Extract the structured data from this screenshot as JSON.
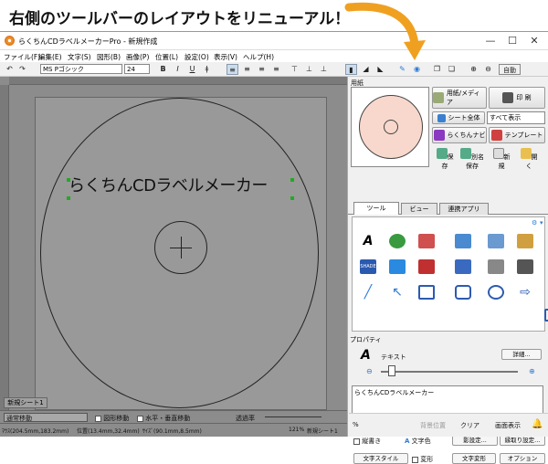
{
  "caption": "右側のツールバーのレイアウトをリニューアル！",
  "window": {
    "title": "らくちんCDラベルメーカーPro - 新規作成",
    "controls": {
      "minimize": "—",
      "maximize": "☐",
      "close": "✕"
    }
  },
  "menu": [
    "ファイル(F)",
    "編集(E)",
    "文字(S)",
    "図形(B)",
    "画像(P)",
    "位置(L)",
    "設定(O)",
    "表示(V)",
    "ヘルプ(H)"
  ],
  "format": {
    "font": "MS Pゴシック",
    "size": "24",
    "bold": "B",
    "italic": "I",
    "underline": "U",
    "strike": "ǂ",
    "zoom_label": "自動"
  },
  "canvas": {
    "label_text": "らくちんCDラベルメーカー"
  },
  "sheet_tab": "新規シート1",
  "status1": {
    "mode": "通常移動",
    "chk1": "図形移動",
    "chk2": "水平・垂直移動",
    "transparency_label": "透過率",
    "percent": "%"
  },
  "status2": {
    "mouse": "ﾏｳｽ(204.5mm,183.2mm)",
    "position": "位置(13.4mm,32.4mm)",
    "size": "ｻｲｽﾞ(90.1mm,8.5mm)",
    "zoom": "121%",
    "sheet": "新規シート1",
    "bg": "背景位置",
    "clear": "クリア",
    "display": "画面表示"
  },
  "panel": {
    "paper_label": "用紙",
    "paper_media": "用紙/メディア",
    "print": "印 刷",
    "sheet_all": "シート全体",
    "display_select": "すべて表示",
    "navi": "らくちんナビ",
    "template": "テンプレート",
    "save": "保存",
    "save_as": "別名保存",
    "new": "新規",
    "open": "開く",
    "tabs": [
      "ツール",
      "ビュー",
      "連携アプリ"
    ],
    "property_label": "プロパティ",
    "prop_type": "テキスト",
    "details": "詳細...",
    "text_value": "らくちんCDラベルメーカー",
    "vertical": "縦書き",
    "text_color": "文字色",
    "shadow_set": "影設定...",
    "outline_set": "縁取り設定...",
    "text_style": "文字スタイル",
    "deform": "変形",
    "text_deform": "文字変形",
    "option": "オプション"
  },
  "colors": {
    "accent": "#f0a020",
    "selection": "#2c7bd6",
    "disc_fill": "#f8d8cc"
  }
}
